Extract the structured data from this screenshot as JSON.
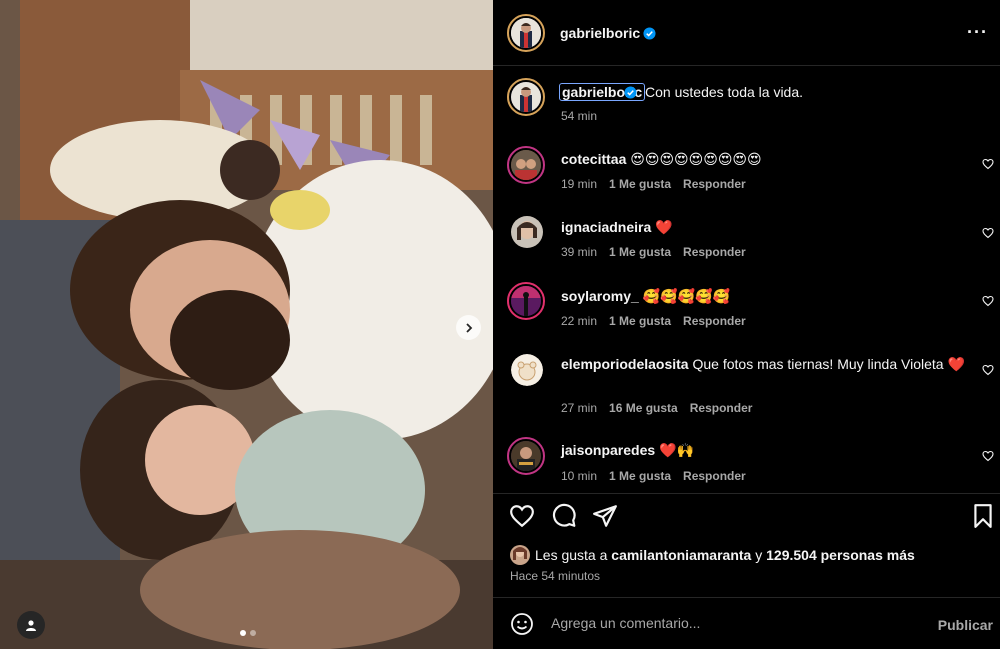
{
  "post": {
    "author": "gabrielboric",
    "caption": "Con ustedes toda la vida.",
    "caption_time": "54 min",
    "carousel": {
      "current": 1,
      "total": 2
    }
  },
  "comments": [
    {
      "user": "cotecittaa",
      "text": "😍😍😍😍😍😍😍😍😍",
      "time": "19 min",
      "likes": "1 Me gusta",
      "reply": "Responder"
    },
    {
      "user": "ignaciadneira",
      "text": "❤️",
      "time": "39 min",
      "likes": "1 Me gusta",
      "reply": "Responder"
    },
    {
      "user": "soylaromy_",
      "text": "🥰🥰🥰🥰🥰",
      "time": "22 min",
      "likes": "1 Me gusta",
      "reply": "Responder"
    },
    {
      "user": "elemporiodelaosita",
      "text": "Que fotos mas tiernas! Muy linda Violeta ❤️",
      "time": "27 min",
      "likes": "16 Me gusta",
      "reply": "Responder"
    },
    {
      "user": "jaisonparedes",
      "text": "❤️🙌",
      "time": "10 min",
      "likes": "1 Me gusta",
      "reply": "Responder"
    }
  ],
  "likes": {
    "prefix": "Les gusta a",
    "user": "camilantoniamaranta",
    "joiner": "y",
    "count": "129.504 personas más"
  },
  "time_ago": "Hace 54 minutos",
  "comment_box": {
    "placeholder": "Agrega un comentario...",
    "publish": "Publicar"
  },
  "icons": {
    "verified": "verified-badge-icon",
    "more": "more-options-icon",
    "like": "heart-icon",
    "comment": "comment-bubble-icon",
    "share": "paper-plane-icon",
    "save": "bookmark-icon",
    "emoji": "emoji-icon",
    "next": "chevron-right-icon",
    "tag": "user-tag-icon"
  },
  "colors": {
    "background": "#000000",
    "text": "#f5f5f5",
    "secondary": "#a8a8a8",
    "verified": "#0095f6",
    "divider": "#262626"
  }
}
